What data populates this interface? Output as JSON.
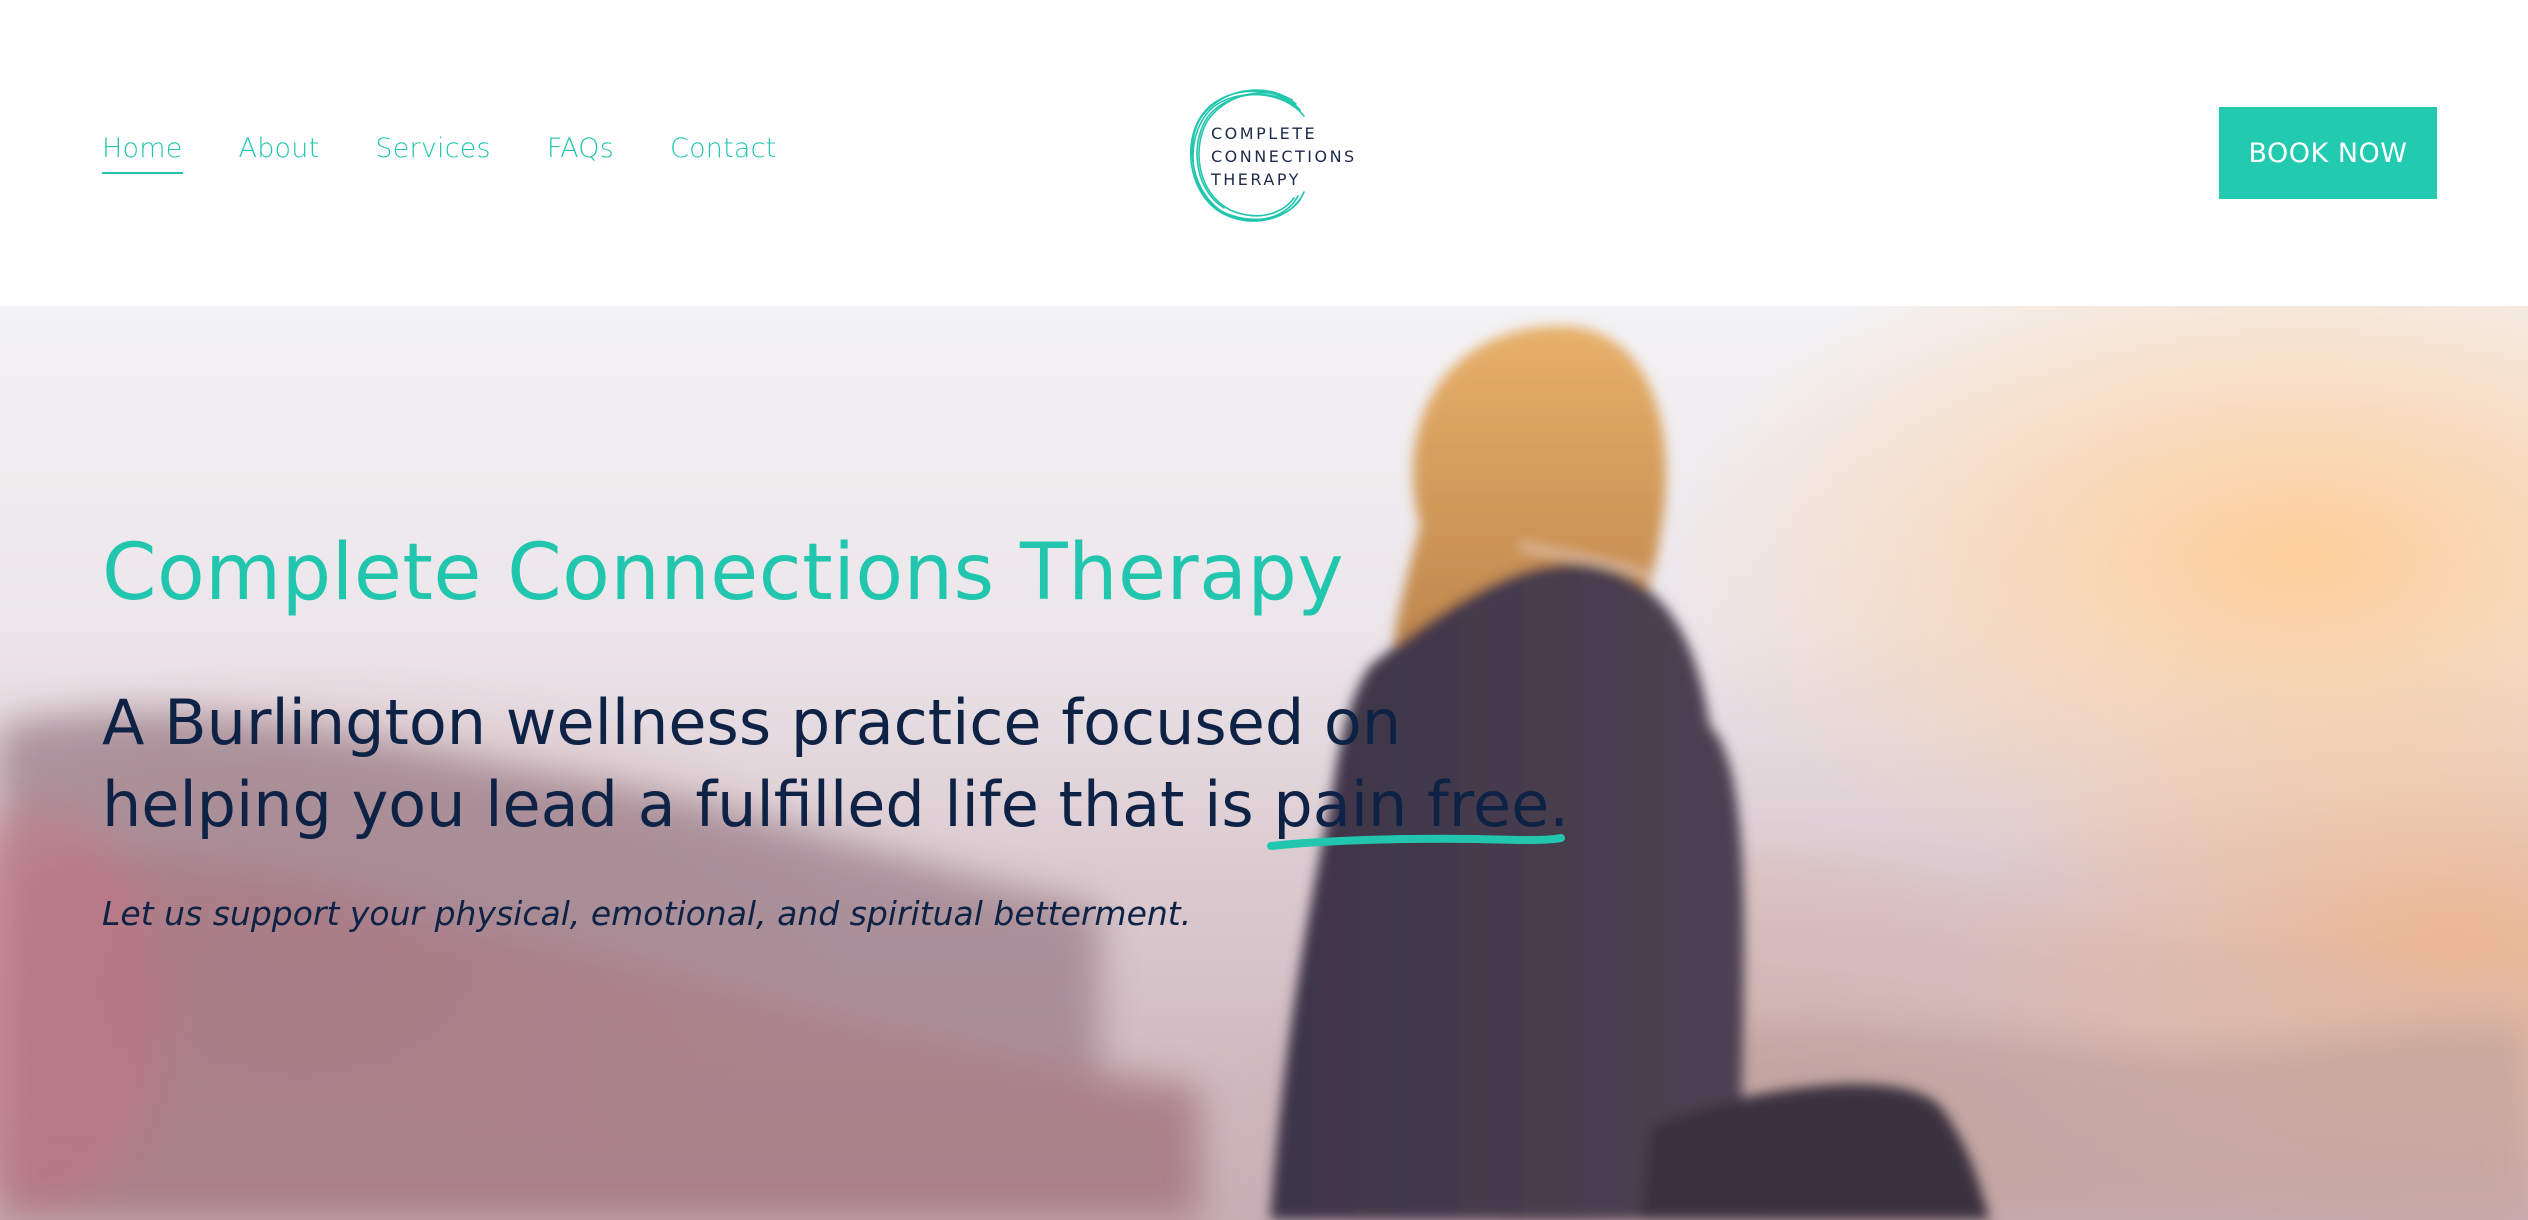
{
  "header": {
    "nav": [
      {
        "label": "Home",
        "active": true
      },
      {
        "label": "About",
        "active": false
      },
      {
        "label": "Services",
        "active": false
      },
      {
        "label": "FAQs",
        "active": false
      },
      {
        "label": "Contact",
        "active": false
      }
    ],
    "logo": {
      "line1": "COMPLETE",
      "line2": "CONNECTIONS",
      "line3": "THERAPY",
      "icon": "circle-swirl-icon"
    },
    "book_button": "BOOK NOW"
  },
  "hero": {
    "title": "Complete Connections Therapy",
    "subtitle_line1": "A Burlington wellness practice focused on",
    "subtitle_line2_prefix": "helping you lead a fulfilled life that is ",
    "subtitle_highlight": "pain free",
    "subtitle_suffix": ".",
    "tagline": "Let us support your physical, emotional, and spiritual betterment.",
    "image": "woman-sitting-on-mountain-at-sunrise"
  },
  "colors": {
    "accent": "#22c6ae",
    "button": "#22cbb0",
    "text_dark": "#0e2245",
    "background": "#ffffff"
  }
}
